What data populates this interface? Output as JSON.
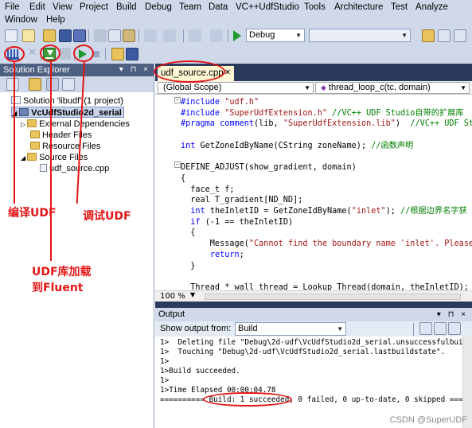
{
  "menu": {
    "row1": [
      "File",
      "Edit",
      "View",
      "Project",
      "Build",
      "Debug",
      "Team",
      "Data",
      "VC++UdfStudio",
      "Tools",
      "Architecture",
      "Test",
      "Analyze"
    ],
    "row2": [
      "Window",
      "Help"
    ]
  },
  "toolbar": {
    "config_combo": "Debug",
    "platform_combo": ""
  },
  "solution_explorer": {
    "title": "Solution Explorer",
    "controls": "▾ ⊓ ×",
    "items": [
      {
        "label": "Solution 'libudf' (1 project)",
        "icon": "solution-icon"
      },
      {
        "label": "VcUdfStudio2d_serial",
        "icon": "project-icon"
      },
      {
        "label": "External Dependencies",
        "icon": "folder-icon"
      },
      {
        "label": "Header Files",
        "icon": "folder-icon"
      },
      {
        "label": "Resource Files",
        "icon": "folder-icon"
      },
      {
        "label": "Source Files",
        "icon": "folder-icon"
      },
      {
        "label": "udf_source.cpp",
        "icon": "cpp-file-icon"
      }
    ]
  },
  "editor": {
    "tab_label": "udf_source.cpp",
    "scope_combo": "(Global Scope)",
    "function_combo": "thread_loop_c(tc, domain)",
    "zoom": "100 %",
    "lines": [
      [
        {
          "t": "#include ",
          "c": "kw"
        },
        {
          "t": "\"udf.h\"",
          "c": "str"
        }
      ],
      [
        {
          "t": "#include ",
          "c": "kw"
        },
        {
          "t": "\"SuperUdfExtension.h\"",
          "c": "str"
        },
        {
          "t": " //VC++ UDF Studio自带的扩展库",
          "c": "cmt"
        }
      ],
      [
        {
          "t": "#pragma ",
          "c": "kw"
        },
        {
          "t": "comment",
          "c": "kw"
        },
        {
          "t": "(lib, ",
          "c": ""
        },
        {
          "t": "\"SuperUdfExtension.lib\"",
          "c": "str"
        },
        {
          "t": ")  ",
          "c": ""
        },
        {
          "t": "//VC++ UDF St",
          "c": "cmt"
        }
      ],
      [],
      [
        {
          "t": "int",
          "c": "kw"
        },
        {
          "t": " GetZoneIdByName(CString zoneName); ",
          "c": ""
        },
        {
          "t": "//函数声明",
          "c": "cmt"
        }
      ],
      [],
      [
        {
          "t": "DEFINE_ADJUST(show_gradient, domain)",
          "c": ""
        }
      ],
      [
        {
          "t": "{",
          "c": ""
        }
      ],
      [
        {
          "t": "  face_t f;",
          "c": ""
        }
      ],
      [
        {
          "t": "  real T_gradient[ND_ND];",
          "c": ""
        }
      ],
      [
        {
          "t": "  ",
          "c": ""
        },
        {
          "t": "int",
          "c": "kw"
        },
        {
          "t": " theInletID = GetZoneIdByName(",
          "c": ""
        },
        {
          "t": "\"inlet\"",
          "c": "str"
        },
        {
          "t": "); ",
          "c": ""
        },
        {
          "t": "//根据边界名字获",
          "c": "cmt"
        }
      ],
      [
        {
          "t": "  ",
          "c": ""
        },
        {
          "t": "if",
          "c": "kw"
        },
        {
          "t": " (-1 == theInletID)",
          "c": ""
        }
      ],
      [
        {
          "t": "  {",
          "c": ""
        }
      ],
      [
        {
          "t": "      Message(",
          "c": ""
        },
        {
          "t": "\"Cannot find the boundary name 'inlet'. Please",
          "c": "str"
        }
      ],
      [
        {
          "t": "      ",
          "c": ""
        },
        {
          "t": "return",
          "c": "kw"
        },
        {
          "t": ";",
          "c": ""
        }
      ],
      [
        {
          "t": "  }",
          "c": ""
        }
      ],
      [],
      [
        {
          "t": "  Thread * wall_thread = Lookup_Thread(domain, theInletID);",
          "c": ""
        }
      ]
    ]
  },
  "output": {
    "title": "Output",
    "controls": "▾ ⊓ ×",
    "show_from_label": "Show output from:",
    "show_from_value": "Build",
    "lines": [
      "1>  Deleting file \"Debug\\2d-udf\\VcUdfStudio2d_serial.unsuccessfulbuild\".",
      "1>  Touching \"Debug\\2d-udf\\VcUdfStudio2d_serial.lastbuildstate\".",
      "1>",
      "1>Build succeeded.",
      "1>",
      "1>Time Elapsed 00:00:04.78"
    ],
    "summary": {
      "prefix": "========== ",
      "highlight": "Build: 1 succeeded,",
      "suffix": " 0 failed, 0 up-to-date, 0 skipped ========="
    }
  },
  "annotations": {
    "compile": "编译UDF",
    "load": "UDF库加载\n到Fluent",
    "debug": "调试UDF",
    "color": "#e41515"
  },
  "watermark": "CSDN @SuperUDF"
}
